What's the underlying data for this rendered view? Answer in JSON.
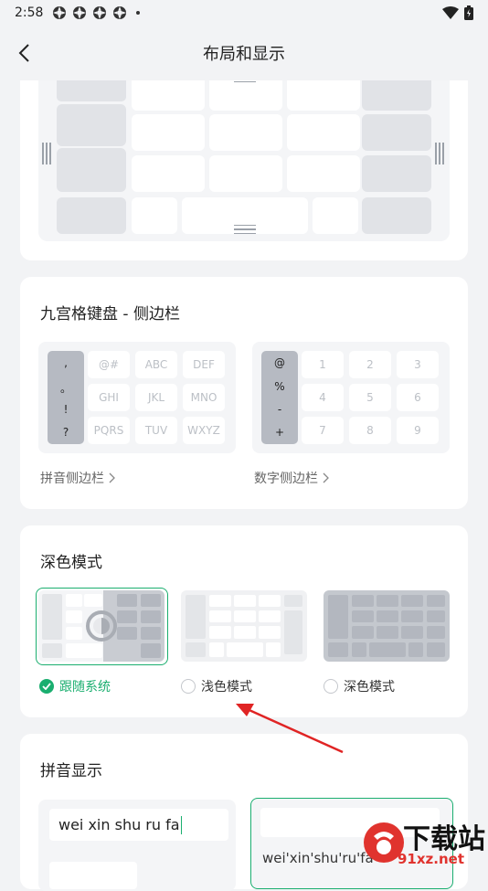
{
  "status_bar": {
    "time": "2:58"
  },
  "header": {
    "title": "布局和显示"
  },
  "nine_grid": {
    "title": "九宫格键盘 - 侧边栏",
    "pinyin": {
      "symbols": [
        ",",
        "。",
        "!",
        "?"
      ],
      "keys": [
        "@#",
        "ABC",
        "DEF",
        "GHI",
        "JKL",
        "MNO",
        "PQRS",
        "TUV",
        "WXYZ"
      ],
      "link": "拼音侧边栏"
    },
    "number": {
      "symbols": [
        "@",
        "%",
        "-",
        "+"
      ],
      "keys": [
        "1",
        "2",
        "3",
        "4",
        "5",
        "6",
        "7",
        "8",
        "9"
      ],
      "link": "数字侧边栏"
    }
  },
  "dark_mode": {
    "title": "深色模式",
    "options": [
      {
        "label": "跟随系统",
        "selected": true
      },
      {
        "label": "浅色模式",
        "selected": false
      },
      {
        "label": "深色模式",
        "selected": false
      }
    ]
  },
  "pinyin_display": {
    "title": "拼音显示",
    "option1_text": "wei xin shu ru fa",
    "option2_text": "wei'xin'shu'ru'fa"
  },
  "watermark": {
    "brand": "下载站",
    "url": "91xz.net"
  },
  "colors": {
    "accent": "#1aae6f",
    "arrow": "#e02424",
    "background": "#f2f3f5"
  }
}
